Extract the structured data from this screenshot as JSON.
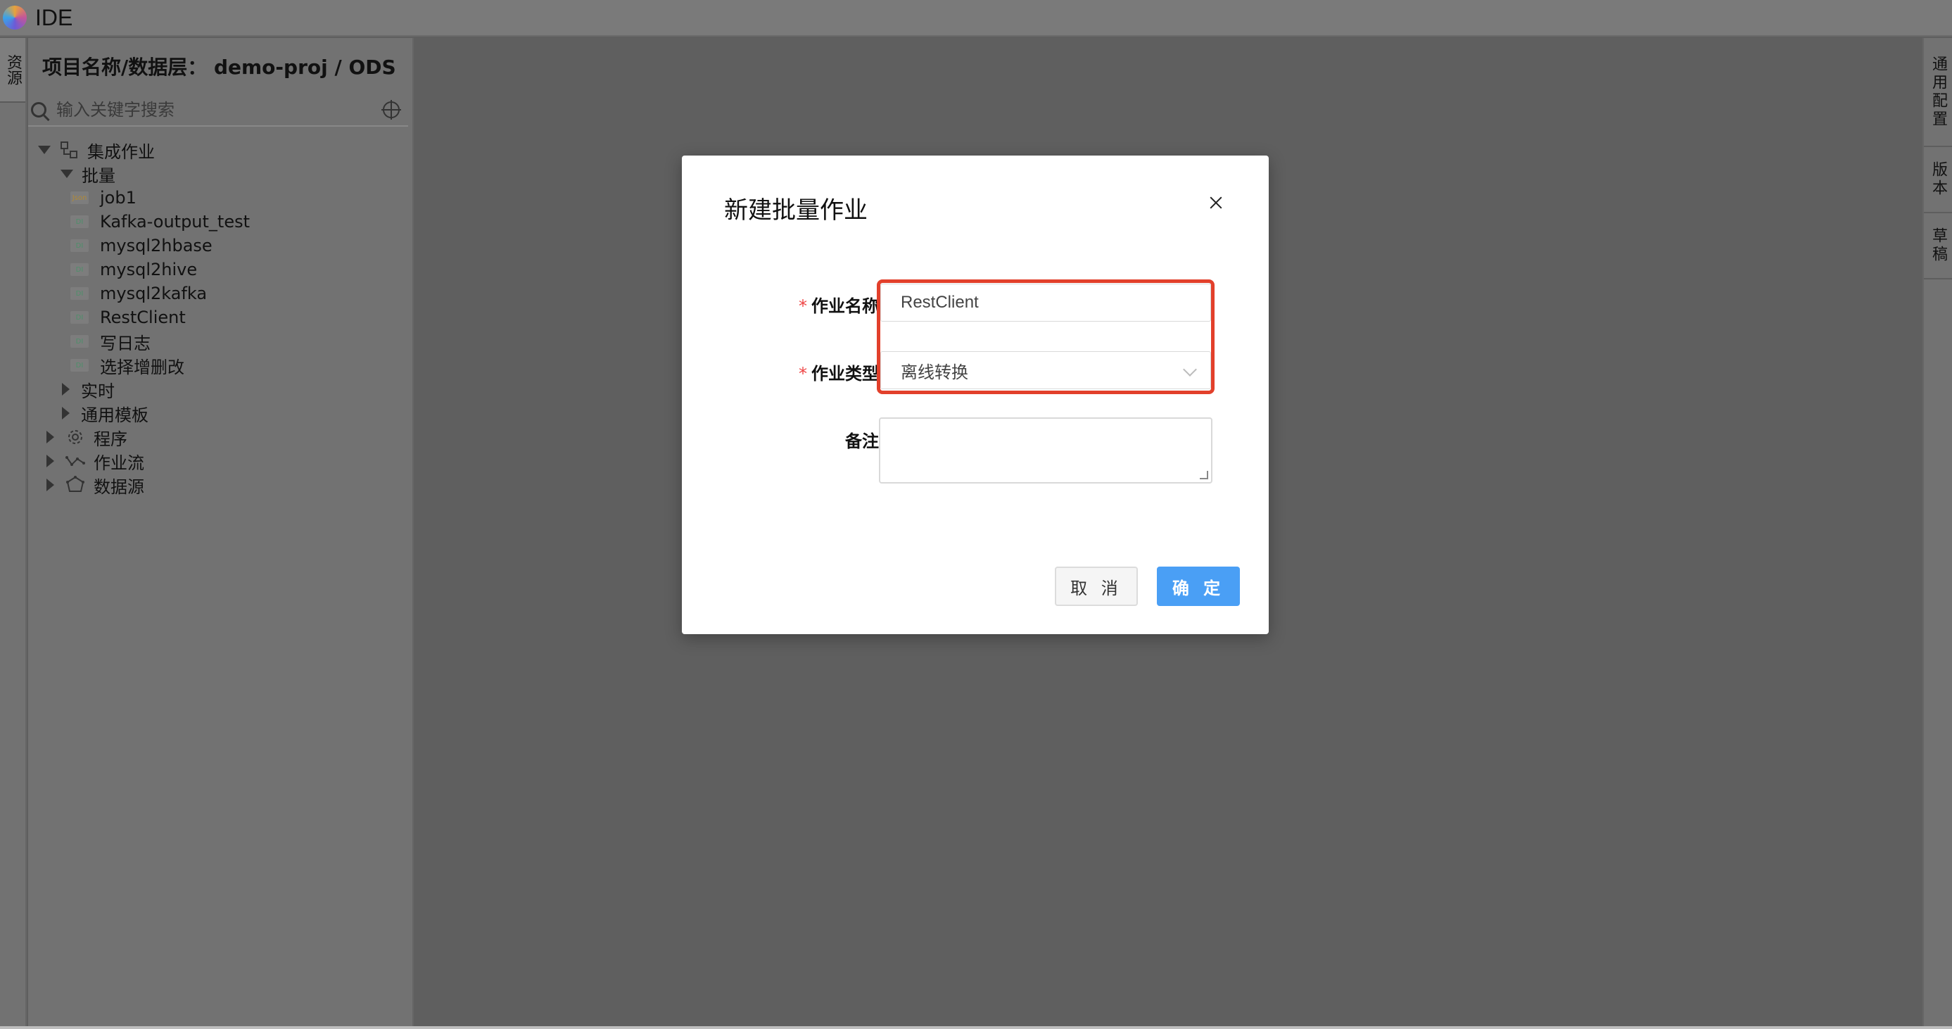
{
  "app": {
    "title": "IDE"
  },
  "left_strip": {
    "tab_label": "资源"
  },
  "panel": {
    "header": "项目名称/数据层： demo-proj / ODS",
    "search_placeholder": "输入关键字搜索",
    "tree": [
      {
        "label": "集成作业",
        "expanded": true,
        "icon": "integration-icon"
      },
      {
        "label": "批量",
        "expanded": true
      },
      {
        "label": "job1",
        "file_badge": "Json"
      },
      {
        "label": "Kafka-output_test",
        "file_badge": "DI"
      },
      {
        "label": "mysql2hbase",
        "file_badge": "DI"
      },
      {
        "label": "mysql2hive",
        "file_badge": "DI"
      },
      {
        "label": "mysql2kafka",
        "file_badge": "DI"
      },
      {
        "label": "RestClient",
        "file_badge": "DI"
      },
      {
        "label": "写日志",
        "file_badge": "DI"
      },
      {
        "label": "选择增删改",
        "file_badge": "DI"
      },
      {
        "label": "实时",
        "expanded": false
      },
      {
        "label": "通用模板",
        "expanded": false
      },
      {
        "label": "程序",
        "expanded": false,
        "icon": "gear-icon"
      },
      {
        "label": "作业流",
        "expanded": false,
        "icon": "workflow-icon"
      },
      {
        "label": "数据源",
        "expanded": false,
        "icon": "datasource-icon"
      }
    ]
  },
  "right_strip": {
    "tabs": [
      "通用配置",
      "版本",
      "草稿"
    ]
  },
  "modal": {
    "title": "新建批量作业",
    "fields": {
      "name_label": "作业名称",
      "name_value": "RestClient",
      "type_label": "作业类型",
      "type_value": "离线转换",
      "remark_label": "备注",
      "required_mark": "*"
    },
    "cancel_label": "取 消",
    "ok_label": "确 定"
  },
  "colors": {
    "primary": "#4a9ff5",
    "highlight": "#e2402b",
    "overlay": "#5f5f5f"
  }
}
